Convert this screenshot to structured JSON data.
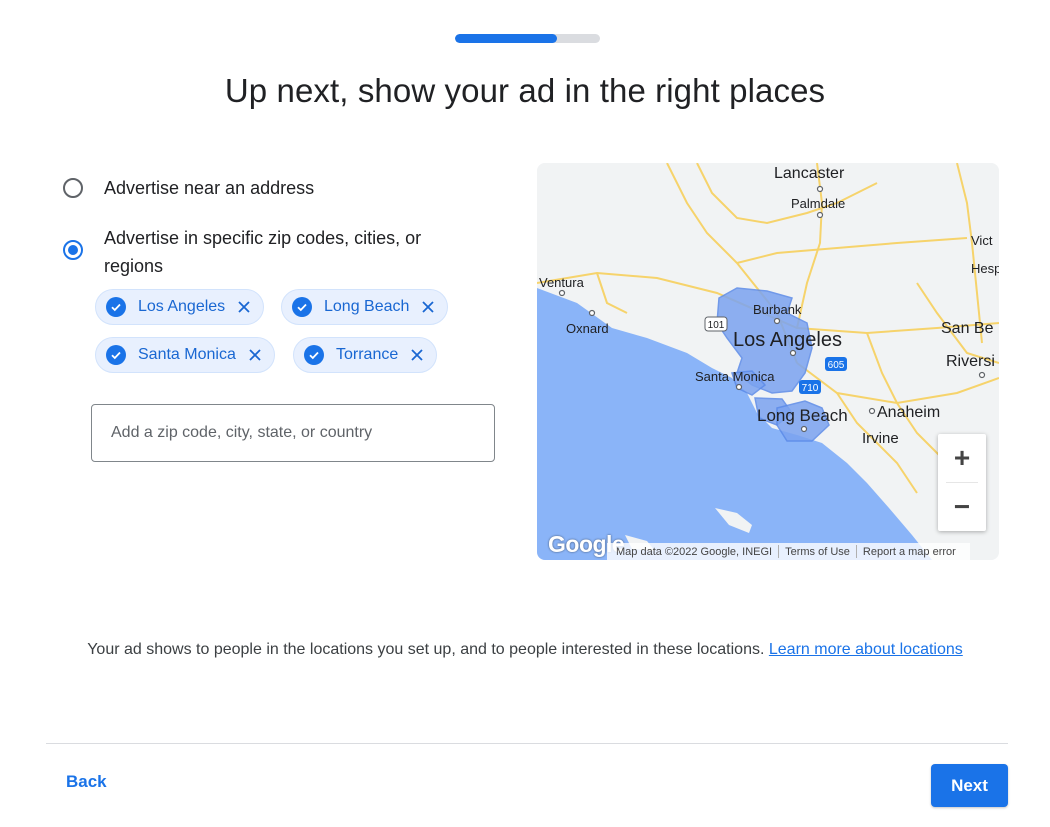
{
  "progress": {
    "fraction": 0.7
  },
  "page_title": "Up next, show your ad in the right places",
  "radio_options": [
    {
      "label": "Advertise near an address",
      "selected": false
    },
    {
      "label": "Advertise in specific zip codes, cities, or regions",
      "selected": true
    }
  ],
  "chips": [
    "Los Angeles",
    "Long Beach",
    "Santa Monica",
    "Torrance"
  ],
  "location_input": {
    "placeholder": "Add a zip code, city, state, or country",
    "value": ""
  },
  "map": {
    "labels": {
      "lancaster": "Lancaster",
      "palmdale": "Palmdale",
      "victorville": "Vict",
      "hesperia": "Hesp",
      "ventura": "Ventura",
      "oxnard": "Oxnard",
      "burbank": "Burbank",
      "los_angeles": "Los Angeles",
      "santa_monica": "Santa Monica",
      "san_bernardino": "San Be",
      "riverside": "Riversi",
      "long_beach": "Long Beach",
      "anaheim": "Anaheim",
      "irvine": "Irvine",
      "route_101": "101",
      "route_605": "605",
      "route_710": "710"
    },
    "zoom_in": "+",
    "zoom_out": "−",
    "google_logo": "Google",
    "footer": {
      "map_data": "Map data ©2022 Google, INEGI",
      "terms": "Terms of Use",
      "report": "Report a map error"
    }
  },
  "info": {
    "text": "Your ad shows to people in the locations you set up, and to people interested in these locations.",
    "link": "Learn more about locations"
  },
  "footer": {
    "back": "Back",
    "next": "Next"
  },
  "colors": {
    "accent": "#1a73e8",
    "chip_bg": "#e8f0fe",
    "water": "#8ab4f8",
    "region": "#7ba3f0"
  }
}
